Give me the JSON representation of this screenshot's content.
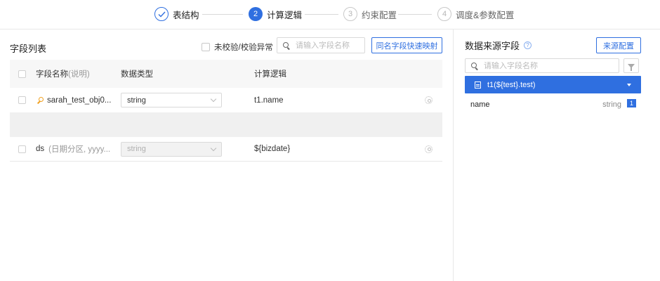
{
  "steps": [
    {
      "num": "",
      "title": "表结构",
      "state": "done"
    },
    {
      "num": "2",
      "title": "计算逻辑",
      "state": "active"
    },
    {
      "num": "3",
      "title": "约束配置",
      "state": "todo"
    },
    {
      "num": "4",
      "title": "调度&参数配置",
      "state": "todo"
    }
  ],
  "left": {
    "title": "字段列表",
    "checkbox_label": "未校验/校验异常",
    "search_placeholder": "请输入字段名称",
    "map_button": "同名字段快速映射",
    "columns": {
      "name": "字段名称",
      "name_hint": "(说明)",
      "type": "数据类型",
      "logic": "计算逻辑"
    },
    "rows": [
      {
        "name": "sarah_test_obj0...",
        "hint": "",
        "type": "string",
        "logic": "t1.name",
        "disabled": false
      },
      {
        "name": "ds",
        "hint": "(日期分区, yyyy...",
        "type": "string",
        "logic": "${bizdate}",
        "disabled": true
      }
    ]
  },
  "right": {
    "title": "数据来源字段",
    "help_glyph": "?",
    "source_button": "来源配置",
    "search_placeholder": "请输入字段名称",
    "source_table": "t1(${test}.test)",
    "fields": [
      {
        "name": "name",
        "type": "string",
        "badge": "1"
      }
    ]
  },
  "colors": {
    "accent": "#2f6fe0",
    "key_icon": "#f0a020"
  }
}
